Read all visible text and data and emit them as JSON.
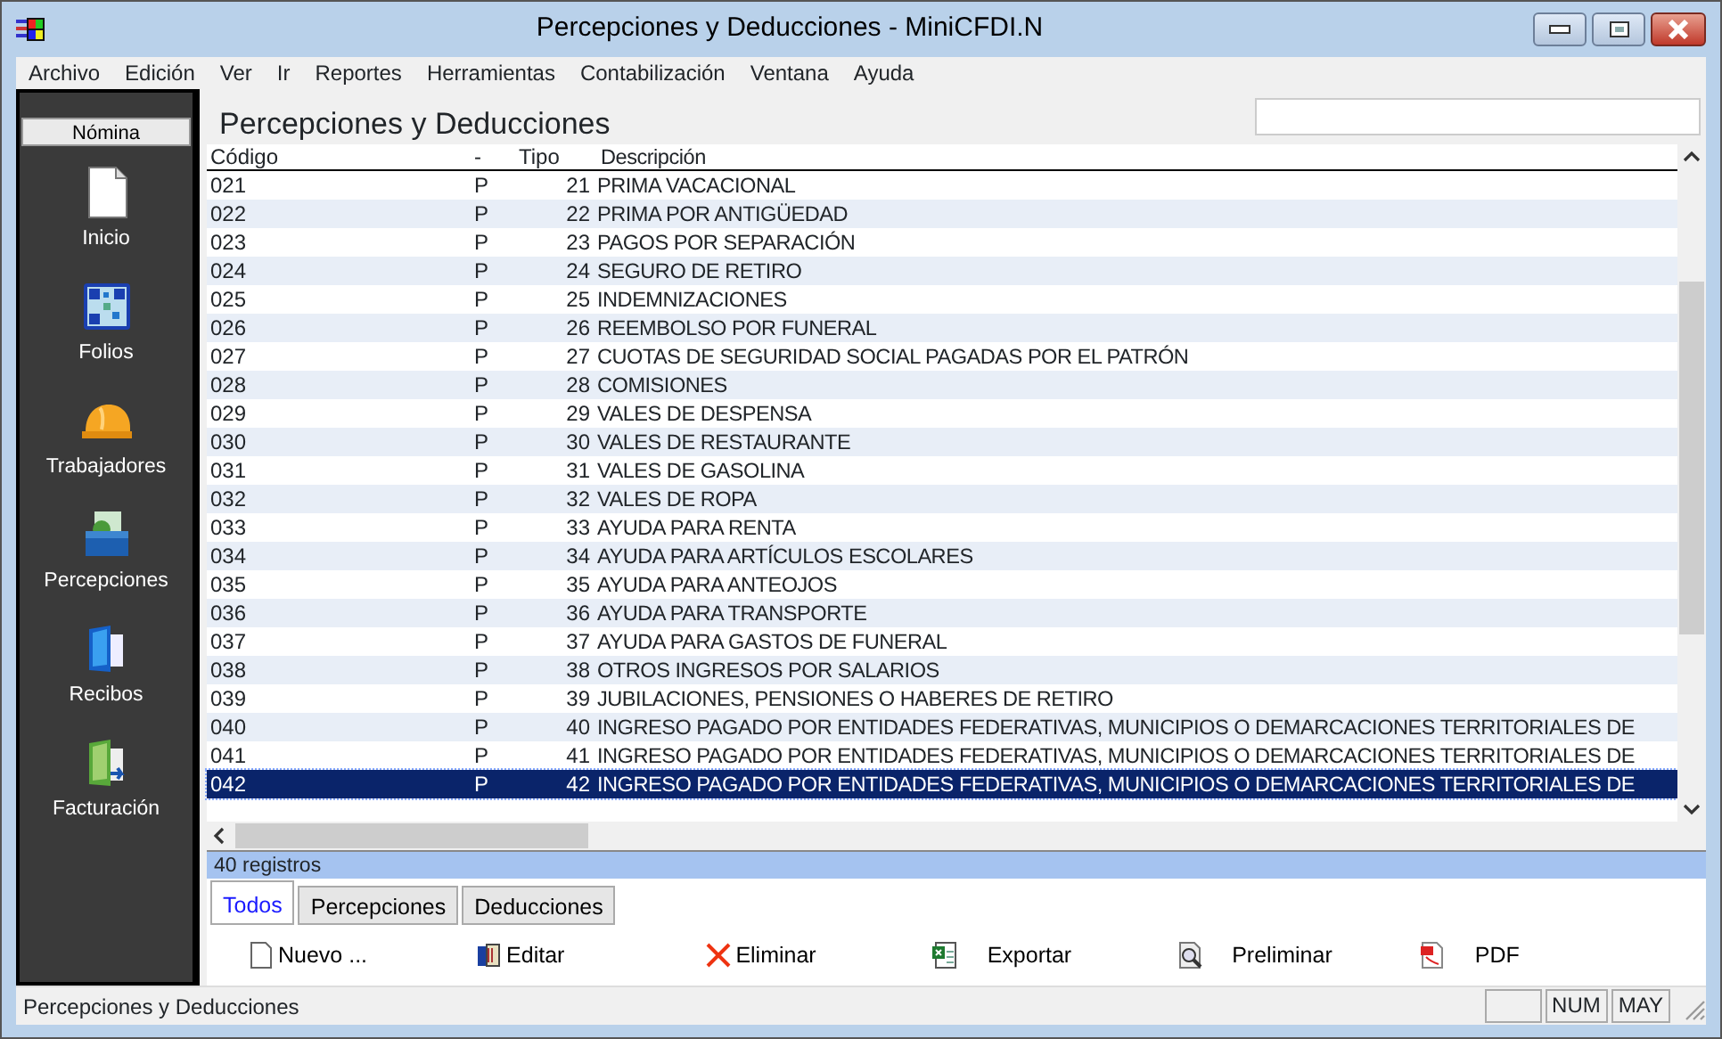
{
  "window": {
    "title": "Percepciones y Deducciones - MiniCFDI.N"
  },
  "menu": [
    "Archivo",
    "Edición",
    "Ver",
    "Ir",
    "Reportes",
    "Herramientas",
    "Contabilización",
    "Ventana",
    "Ayuda"
  ],
  "sidebar": {
    "header": "Nómina",
    "items": [
      {
        "label": "Inicio",
        "kind": "document"
      },
      {
        "label": "Folios",
        "kind": "qr"
      },
      {
        "label": "Trabajadores",
        "kind": "helmet"
      },
      {
        "label": "Percepciones",
        "kind": "box"
      },
      {
        "label": "Recibos",
        "kind": "bluefolder"
      },
      {
        "label": "Facturación",
        "kind": "greenfolder"
      }
    ]
  },
  "page_title": "Percepciones y Deducciones",
  "table": {
    "columns": [
      "Código",
      "-",
      "Tipo",
      "Descripción"
    ],
    "rows": [
      {
        "code": "021",
        "sign": "P",
        "type": "21",
        "description": "PRIMA VACACIONAL",
        "selected": false
      },
      {
        "code": "022",
        "sign": "P",
        "type": "22",
        "description": "PRIMA POR ANTIGÜEDAD",
        "selected": false
      },
      {
        "code": "023",
        "sign": "P",
        "type": "23",
        "description": "PAGOS POR SEPARACIÓN",
        "selected": false
      },
      {
        "code": "024",
        "sign": "P",
        "type": "24",
        "description": "SEGURO DE RETIRO",
        "selected": false
      },
      {
        "code": "025",
        "sign": "P",
        "type": "25",
        "description": "INDEMNIZACIONES",
        "selected": false
      },
      {
        "code": "026",
        "sign": "P",
        "type": "26",
        "description": "REEMBOLSO POR FUNERAL",
        "selected": false
      },
      {
        "code": "027",
        "sign": "P",
        "type": "27",
        "description": "CUOTAS DE SEGURIDAD SOCIAL PAGADAS POR EL PATRÓN",
        "selected": false
      },
      {
        "code": "028",
        "sign": "P",
        "type": "28",
        "description": "COMISIONES",
        "selected": false
      },
      {
        "code": "029",
        "sign": "P",
        "type": "29",
        "description": "VALES DE DESPENSA",
        "selected": false
      },
      {
        "code": "030",
        "sign": "P",
        "type": "30",
        "description": "VALES DE RESTAURANTE",
        "selected": false
      },
      {
        "code": "031",
        "sign": "P",
        "type": "31",
        "description": "VALES DE GASOLINA",
        "selected": false
      },
      {
        "code": "032",
        "sign": "P",
        "type": "32",
        "description": "VALES DE ROPA",
        "selected": false
      },
      {
        "code": "033",
        "sign": "P",
        "type": "33",
        "description": "AYUDA PARA RENTA",
        "selected": false
      },
      {
        "code": "034",
        "sign": "P",
        "type": "34",
        "description": "AYUDA PARA ARTÍCULOS ESCOLARES",
        "selected": false
      },
      {
        "code": "035",
        "sign": "P",
        "type": "35",
        "description": "AYUDA PARA ANTEOJOS",
        "selected": false
      },
      {
        "code": "036",
        "sign": "P",
        "type": "36",
        "description": "AYUDA PARA TRANSPORTE",
        "selected": false
      },
      {
        "code": "037",
        "sign": "P",
        "type": "37",
        "description": "AYUDA PARA GASTOS DE FUNERAL",
        "selected": false
      },
      {
        "code": "038",
        "sign": "P",
        "type": "38",
        "description": "OTROS INGRESOS POR SALARIOS",
        "selected": false
      },
      {
        "code": "039",
        "sign": "P",
        "type": "39",
        "description": "JUBILACIONES, PENSIONES O HABERES DE RETIRO",
        "selected": false
      },
      {
        "code": "040",
        "sign": "P",
        "type": "40",
        "description": "INGRESO PAGADO POR ENTIDADES FEDERATIVAS, MUNICIPIOS O DEMARCACIONES TERRITORIALES DE",
        "selected": false
      },
      {
        "code": "041",
        "sign": "P",
        "type": "41",
        "description": "INGRESO PAGADO POR ENTIDADES FEDERATIVAS, MUNICIPIOS O DEMARCACIONES TERRITORIALES DE",
        "selected": false
      },
      {
        "code": "042",
        "sign": "P",
        "type": "42",
        "description": "INGRESO PAGADO POR ENTIDADES FEDERATIVAS, MUNICIPIOS O DEMARCACIONES TERRITORIALES DE",
        "selected": true
      }
    ]
  },
  "record_count": "40 registros",
  "tabs": [
    {
      "label": "Todos",
      "selected": true
    },
    {
      "label": "Percepciones",
      "selected": false
    },
    {
      "label": "Deducciones",
      "selected": false
    }
  ],
  "actions": [
    {
      "label": "Nuevo ...",
      "kind": "new"
    },
    {
      "label": "Editar",
      "kind": "edit"
    },
    {
      "label": "Eliminar",
      "kind": "delete"
    },
    {
      "label": "Exportar",
      "kind": "export"
    },
    {
      "label": "Preliminar",
      "kind": "preview"
    },
    {
      "label": "PDF",
      "kind": "pdf"
    }
  ],
  "status_bar": {
    "text": "Percepciones y Deducciones",
    "indicators": [
      "NUM",
      "MAY"
    ]
  }
}
